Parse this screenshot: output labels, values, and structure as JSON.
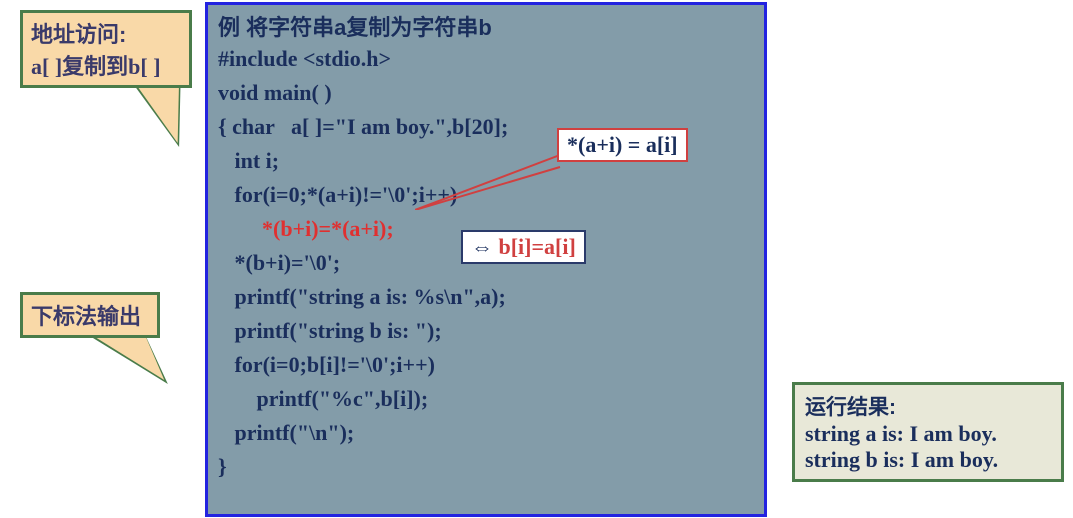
{
  "callouts": {
    "c1_line1": "地址访问:",
    "c1_line2": "a[ ]复制到b[ ]",
    "c2": "下标法输出"
  },
  "code": {
    "title": "例 将字符串a复制为字符串b",
    "l1": "#include <stdio.h>",
    "l2": "void main( )",
    "l3": "{ char   a[ ]=\"I am boy.\",b[20];",
    "l4": "   int i;",
    "l5": "   for(i=0;*(a+i)!='\\0';i++)",
    "l6": "        *(b+i)=*(a+i);",
    "l7": "   *(b+i)='\\0';",
    "l8": "   printf(\"string a is: %s\\n\",a);",
    "l9": "   printf(\"string b is: \");",
    "l10": "   for(i=0;b[i]!='\\0';i++)",
    "l11": "       printf(\"%c\",b[i]);",
    "l12": "   printf(\"\\n\");",
    "l13": "}"
  },
  "annotations": {
    "a1": "*(a+i) = a[i]",
    "a2_arrow": "⇔ ",
    "a2_text": "b[i]=a[i]"
  },
  "result": {
    "title": "运行结果:",
    "r1": "string a is: I am boy.",
    "r2": "string b is: I am boy."
  }
}
